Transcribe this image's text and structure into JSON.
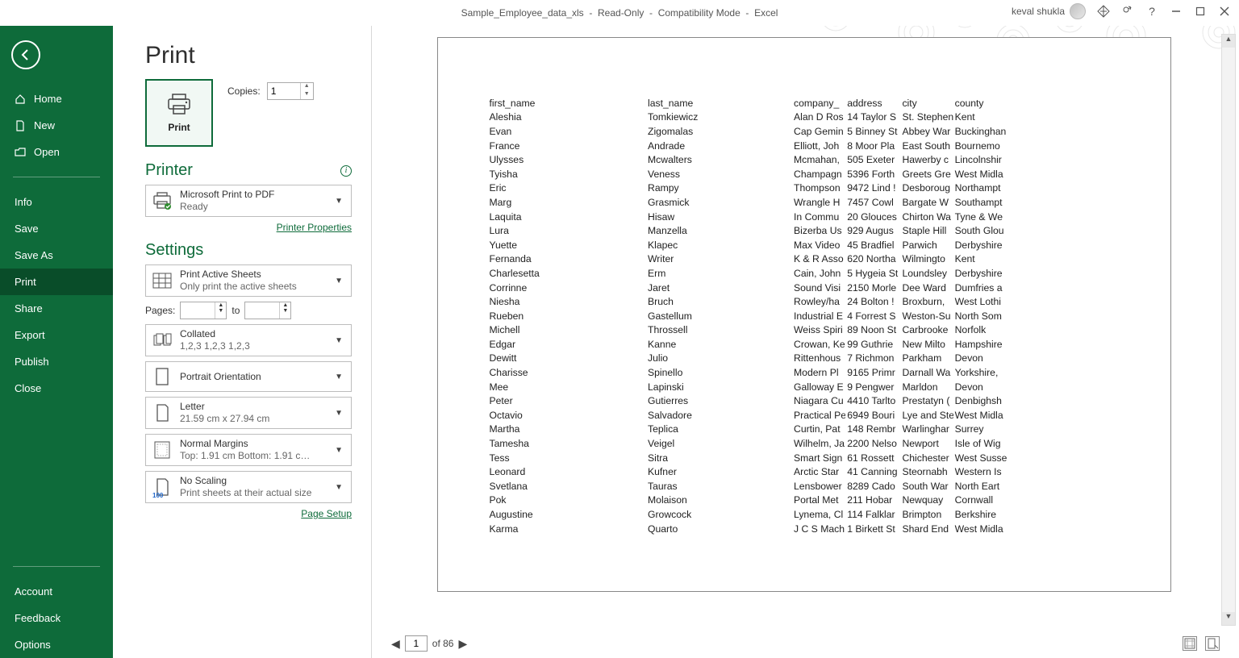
{
  "titlebar": {
    "doc": "Sample_Employee_data_xls",
    "readonly": "Read-Only",
    "compat": "Compatibility Mode",
    "app": "Excel",
    "user": "keval shukla"
  },
  "sidebar": {
    "home": "Home",
    "new": "New",
    "open": "Open",
    "info": "Info",
    "save": "Save",
    "saveas": "Save As",
    "print": "Print",
    "share": "Share",
    "export": "Export",
    "publish": "Publish",
    "close": "Close",
    "account": "Account",
    "feedback": "Feedback",
    "options": "Options"
  },
  "print": {
    "heading": "Print",
    "copies_label": "Copies:",
    "copies_value": "1",
    "print_btn": "Print",
    "printer_heading": "Printer",
    "printer_name": "Microsoft Print to PDF",
    "printer_status": "Ready",
    "printer_props": "Printer Properties",
    "settings_heading": "Settings",
    "active_t1": "Print Active Sheets",
    "active_t2": "Only print the active sheets",
    "pages_label": "Pages:",
    "pages_to": "to",
    "collated_t1": "Collated",
    "collated_t2": "1,2,3    1,2,3    1,2,3",
    "orient_t1": "Portrait Orientation",
    "paper_t1": "Letter",
    "paper_t2": "21.59 cm x 27.94 cm",
    "margins_t1": "Normal Margins",
    "margins_t2": "Top: 1.91 cm Bottom: 1.91 c…",
    "scaling_t1": "No Scaling",
    "scaling_t2": "Print sheets at their actual size",
    "scaling_badge": "100",
    "page_setup": "Page Setup",
    "nav_current": "1",
    "nav_total": "of 86"
  },
  "preview": {
    "headers": [
      "first_name",
      "last_name",
      "company_",
      "address",
      "city",
      "county"
    ],
    "rows": [
      [
        "Aleshia",
        "Tomkiewicz",
        "Alan D Ros",
        "14 Taylor S",
        "St. Stephen",
        "Kent"
      ],
      [
        "Evan",
        "Zigomalas",
        "Cap Gemin",
        "5 Binney St",
        "Abbey War",
        "Buckinghan"
      ],
      [
        "France",
        "Andrade",
        "Elliott, Joh",
        "8 Moor Pla",
        "East South",
        "Bournemo"
      ],
      [
        "Ulysses",
        "Mcwalters",
        "Mcmahan,",
        "505 Exeter",
        "Hawerby c",
        "Lincolnshir"
      ],
      [
        "Tyisha",
        "Veness",
        "Champagn",
        "5396 Forth",
        "Greets Gre",
        "West Midla"
      ],
      [
        "Eric",
        "Rampy",
        "Thompson",
        "9472 Lind !",
        "Desboroug",
        "Northampt"
      ],
      [
        "Marg",
        "Grasmick",
        "Wrangle H",
        "7457 Cowl",
        "Bargate W",
        "Southampt"
      ],
      [
        "Laquita",
        "Hisaw",
        "In Commu",
        "20 Glouces",
        "Chirton Wa",
        "Tyne & We"
      ],
      [
        "Lura",
        "Manzella",
        "Bizerba Us",
        "929 Augus",
        "Staple Hill",
        "South Glou"
      ],
      [
        "Yuette",
        "Klapec",
        "Max Video",
        "45 Bradfiel",
        "Parwich",
        "Derbyshire"
      ],
      [
        "Fernanda",
        "Writer",
        "K & R Asso",
        "620 Northa",
        "Wilmingto",
        "Kent"
      ],
      [
        "Charlesetta",
        "Erm",
        "Cain, John",
        "5 Hygeia St",
        "Loundsley",
        "Derbyshire"
      ],
      [
        "Corrinne",
        "Jaret",
        "Sound Visi",
        "2150 Morle",
        "Dee Ward",
        "Dumfries a"
      ],
      [
        "Niesha",
        "Bruch",
        "Rowley/ha",
        "24 Bolton !",
        "Broxburn,",
        "West Lothi"
      ],
      [
        "Rueben",
        "Gastellum",
        "Industrial E",
        "4 Forrest S",
        "Weston-Su",
        "North Som"
      ],
      [
        "Michell",
        "Throssell",
        "Weiss Spiri",
        "89 Noon St",
        "Carbrooke",
        "Norfolk"
      ],
      [
        "Edgar",
        "Kanne",
        "Crowan, Ke",
        "99 Guthrie",
        "New Milto",
        "Hampshire"
      ],
      [
        "Dewitt",
        "Julio",
        "Rittenhous",
        "7 Richmon",
        "Parkham",
        "Devon"
      ],
      [
        "Charisse",
        "Spinello",
        "Modern Pl",
        "9165 Primr",
        "Darnall Wa",
        "Yorkshire,"
      ],
      [
        "Mee",
        "Lapinski",
        "Galloway E",
        "9 Pengwer",
        "Marldon",
        "Devon"
      ],
      [
        "Peter",
        "Gutierres",
        "Niagara Cu",
        "4410 Tarlto",
        "Prestatyn (",
        "Denbighsh"
      ],
      [
        "Octavio",
        "Salvadore",
        "Practical Pe",
        "6949 Bouri",
        "Lye and Ste",
        "West Midla"
      ],
      [
        "Martha",
        "Teplica",
        "Curtin, Pat",
        "148 Rembr",
        "Warlinghar",
        "Surrey"
      ],
      [
        "Tamesha",
        "Veigel",
        "Wilhelm, Ja",
        "2200 Nelso",
        "Newport",
        "Isle of Wig"
      ],
      [
        "Tess",
        "Sitra",
        "Smart Sign",
        "61 Rossett",
        "Chichester",
        "West Susse"
      ],
      [
        "Leonard",
        "Kufner",
        "Arctic Star",
        "41 Canning",
        "Steornabh",
        "Western Is"
      ],
      [
        "Svetlana",
        "Tauras",
        "Lensbower",
        "8289 Cado",
        "South War",
        "North Eart"
      ],
      [
        "Pok",
        "Molaison",
        "Portal Met",
        "211 Hobar",
        "Newquay",
        "Cornwall"
      ],
      [
        "Augustine",
        "Growcock",
        "Lynema, Cl",
        "114 Falklar",
        "Brimpton",
        "Berkshire"
      ],
      [
        "Karma",
        "Quarto",
        "J C S Mach",
        "1 Birkett St",
        "Shard End",
        "West Midla"
      ]
    ]
  }
}
